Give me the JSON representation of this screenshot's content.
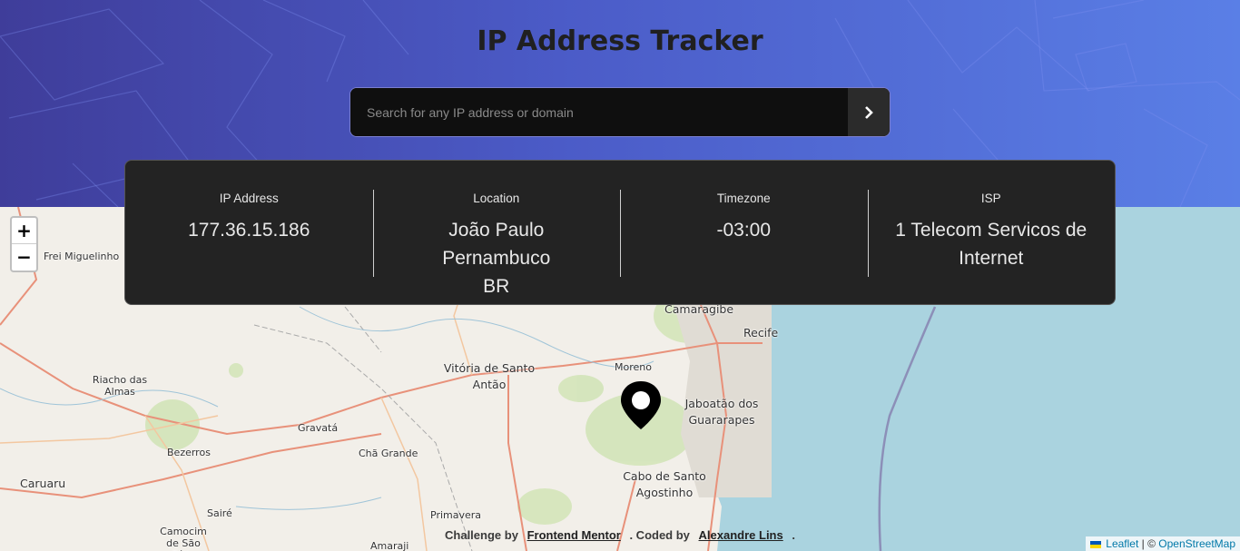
{
  "header": {
    "title": "IP Address Tracker",
    "search_placeholder": "Search for any IP address or domain",
    "search_value": "",
    "submit_icon": "chevron-right-icon"
  },
  "info": [
    {
      "label": "IP Address",
      "value": "177.36.15.186"
    },
    {
      "label": "Location",
      "value": "João Paulo Pernambuco BR"
    },
    {
      "label": "Timezone",
      "value": "-03:00"
    },
    {
      "label": "ISP",
      "value": "1 Telecom Servicos de Internet"
    }
  ],
  "map": {
    "zoom_in": "+",
    "zoom_out": "−",
    "marker_icon": "location-pin-icon",
    "towns": {
      "frei_miguelinho": "Frei Miguelinho",
      "camaragibe": "Camaragibe",
      "recife": "Recife",
      "riacho_das_almas": "Riacho das Almas",
      "vitoria": "Vitória de Santo Antão",
      "moreno": "Moreno",
      "jaboatao": "Jaboatão dos Guararapes",
      "gravata": "Gravatá",
      "bezerros": "Bezerros",
      "cha_grande": "Chã Grande",
      "caruaru": "Caruaru",
      "cabo": "Cabo de Santo Agostinho",
      "saire": "Sairé",
      "primavera": "Primavera",
      "camocim": "Camocim de São Félix",
      "amaraji": "Amaraji"
    },
    "colors": {
      "sea": "#aad3df",
      "land": "#f2efe9",
      "road": "#e8917a"
    }
  },
  "footer": {
    "challenge_text": "Challenge by",
    "challenge_link": "Frontend Mentor",
    "coded_text": ". Coded by",
    "author_link": "Alexandre Lins",
    "end": "."
  },
  "attribution": {
    "leaflet": "Leaflet",
    "separator": "| ©",
    "osm": "OpenStreetMap"
  }
}
